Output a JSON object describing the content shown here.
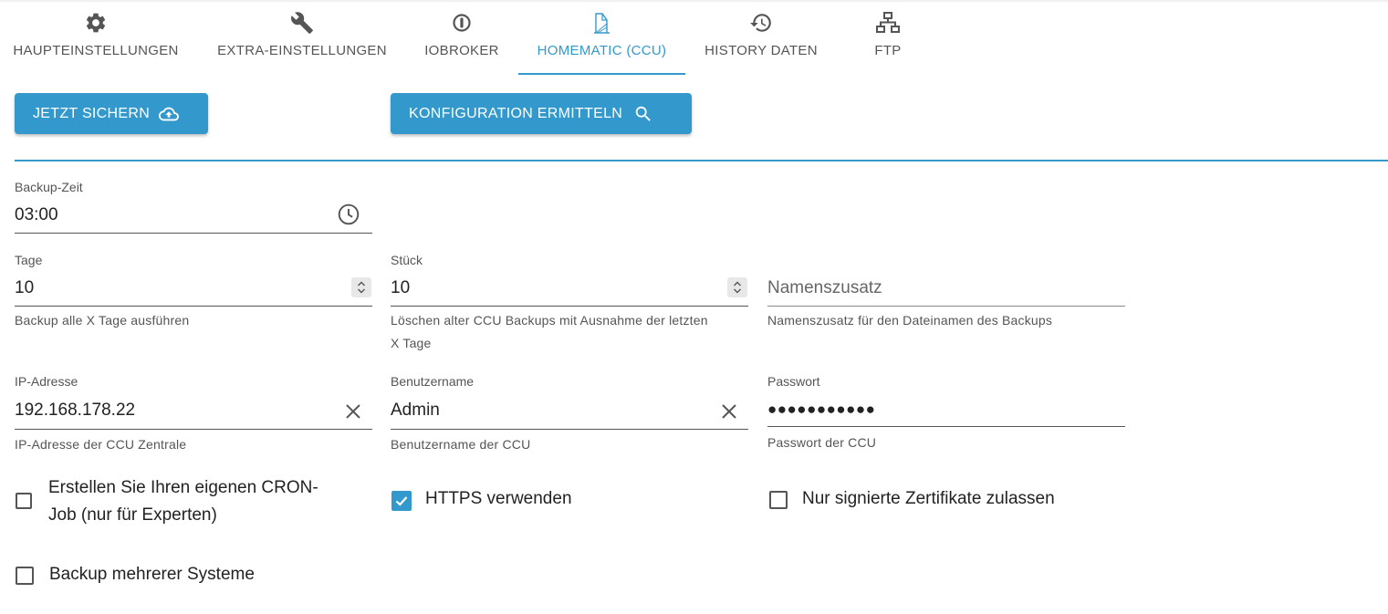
{
  "tabs": [
    {
      "label": "HAUPTEINSTELLUNGEN",
      "icon": "gear-icon"
    },
    {
      "label": "EXTRA-EINSTELLUNGEN",
      "icon": "wrench-icon"
    },
    {
      "label": "IOBROKER",
      "icon": "iobroker-icon"
    },
    {
      "label": "HOMEMATIC (CCU)",
      "icon": "homematic-icon",
      "active": true
    },
    {
      "label": "HISTORY DATEN",
      "icon": "history-icon"
    },
    {
      "label": "FTP",
      "icon": "network-icon"
    }
  ],
  "actions": {
    "backup_now": {
      "label": "JETZT SICHERN",
      "icon": "cloud-upload-icon"
    },
    "detect_config": {
      "label": "KONFIGURATION ERMITTELN",
      "icon": "search-icon"
    }
  },
  "fields": {
    "backup_time": {
      "label": "Backup-Zeit",
      "value": "03:00",
      "icon": "clock-icon"
    },
    "days": {
      "label": "Tage",
      "value": "10",
      "help": "Backup alle X Tage ausführen"
    },
    "pieces": {
      "label": "Stück",
      "value": "10",
      "help_line1": "Löschen alter CCU Backups mit Ausnahme der letzten",
      "help_line2": "X Tage"
    },
    "name_suffix": {
      "placeholder": "Namenszusatz",
      "help": "Namenszusatz für den Dateinamen des Backups"
    },
    "ip": {
      "label": "IP-Adresse",
      "value": "192.168.178.22",
      "help": "IP-Adresse der CCU Zentrale"
    },
    "username": {
      "label": "Benutzername",
      "value": "Admin",
      "help": "Benutzername der CCU"
    },
    "password": {
      "label": "Passwort",
      "value": "●●●●●●●●●●●",
      "help": "Passwort der CCU"
    }
  },
  "checkboxes": {
    "own_cron": {
      "label_line1": "Erstellen Sie Ihren eigenen CRON-",
      "label_line2": "Job (nur für Experten)",
      "checked": false
    },
    "https": {
      "label": "HTTPS verwenden",
      "checked": true
    },
    "signed_certs": {
      "label": "Nur signierte Zertifikate zulassen",
      "checked": false
    },
    "multi_system": {
      "label": "Backup mehrerer Systeme",
      "checked": false
    }
  },
  "colors": {
    "accent": "#3399cc",
    "text": "#222222",
    "muted": "#555555"
  }
}
